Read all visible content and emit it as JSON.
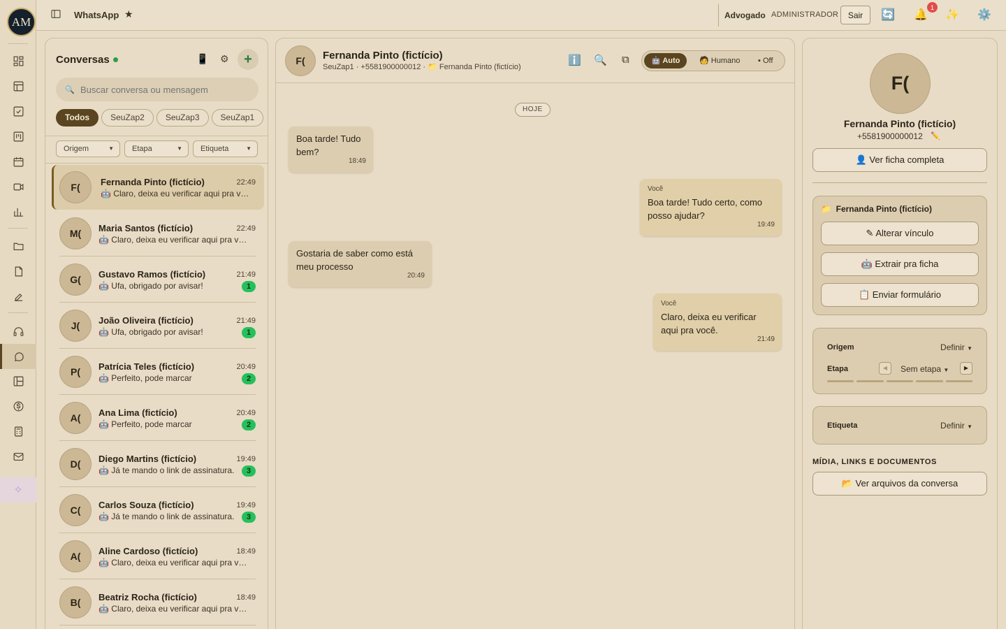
{
  "app": {
    "title": "WhatsApp",
    "logo_text": "AM"
  },
  "topbar": {
    "role": "Advogado",
    "role_sub": "ADMINISTRADOR",
    "logout_label": "Sair",
    "notification_count": "1"
  },
  "conversations": {
    "title": "Conversas",
    "search_placeholder": "Buscar conversa ou mensagem",
    "chips": [
      "Todos",
      "SeuZap2",
      "SeuZap3",
      "SeuZap1"
    ],
    "filters": [
      "Origem",
      "Etapa",
      "Etiqueta"
    ],
    "items": [
      {
        "initials": "F(",
        "name": "Fernanda Pinto (fictício)",
        "time": "22:49",
        "preview": "🤖 Claro, deixa eu verificar aqui pra você.",
        "unread": ""
      },
      {
        "initials": "M(",
        "name": "Maria Santos (fictício)",
        "time": "22:49",
        "preview": "🤖 Claro, deixa eu verificar aqui pra você.",
        "unread": ""
      },
      {
        "initials": "G(",
        "name": "Gustavo Ramos (fictício)",
        "time": "21:49",
        "preview": "🤖 Ufa, obrigado por avisar!",
        "unread": "1"
      },
      {
        "initials": "J(",
        "name": "João Oliveira (fictício)",
        "time": "21:49",
        "preview": "🤖 Ufa, obrigado por avisar!",
        "unread": "1"
      },
      {
        "initials": "P(",
        "name": "Patrícia Teles (fictício)",
        "time": "20:49",
        "preview": "🤖 Perfeito, pode marcar",
        "unread": "2"
      },
      {
        "initials": "A(",
        "name": "Ana Lima (fictício)",
        "time": "20:49",
        "preview": "🤖 Perfeito, pode marcar",
        "unread": "2"
      },
      {
        "initials": "D(",
        "name": "Diego Martins (fictício)",
        "time": "19:49",
        "preview": "🤖 Já te mando o link de assinatura.",
        "unread": "3"
      },
      {
        "initials": "C(",
        "name": "Carlos Souza (fictício)",
        "time": "19:49",
        "preview": "🤖 Já te mando o link de assinatura.",
        "unread": "3"
      },
      {
        "initials": "A(",
        "name": "Aline Cardoso (fictício)",
        "time": "18:49",
        "preview": "🤖 Claro, deixa eu verificar aqui pra você.",
        "unread": ""
      },
      {
        "initials": "B(",
        "name": "Beatriz Rocha (fictício)",
        "time": "18:49",
        "preview": "🤖 Claro, deixa eu verificar aqui pra você.",
        "unread": ""
      }
    ]
  },
  "chat": {
    "initials": "F(",
    "name": "Fernanda Pinto (fictício)",
    "subtitle": "SeuZap1 · +5581900000012 · 📁 Fernanda Pinto (fictício)",
    "modes": [
      "🤖 Auto",
      "🧑 Humano",
      "▪ Off"
    ],
    "date_label": "HOJE",
    "messages": [
      {
        "direction": "in",
        "sender": "",
        "text": "Boa tarde! Tudo bem?",
        "time": "18:49"
      },
      {
        "direction": "out",
        "sender": "Você",
        "text": "Boa tarde! Tudo certo, como posso ajudar?",
        "time": "19:49"
      },
      {
        "direction": "in",
        "sender": "",
        "text": "Gostaria de saber como está meu processo",
        "time": "20:49"
      },
      {
        "direction": "out",
        "sender": "Você",
        "text": "Claro, deixa eu verificar aqui pra você.",
        "time": "21:49"
      }
    ]
  },
  "contact": {
    "initials": "F(",
    "name": "Fernanda Pinto (fictício)",
    "phone": "+5581900000012",
    "view_full": "👤 Ver ficha completa",
    "case_title": "Fernanda Pinto (fictício)",
    "actions": [
      "✎ Alterar vínculo",
      "🤖 Extrair pra ficha",
      "📋 Enviar formulário"
    ],
    "origem_label": "Origem",
    "origem_value": "Definir",
    "etapa_label": "Etapa",
    "etapa_value": "Sem etapa",
    "etiqueta_label": "Etiqueta",
    "etiqueta_value": "Definir",
    "media_title": "MÍDIA, LINKS E DOCUMENTOS",
    "media_button": "📂 Ver arquivos da conversa"
  },
  "colors": {
    "accent": "#5a4520",
    "background": "#e8dcc6",
    "unread": "#25c05a"
  }
}
